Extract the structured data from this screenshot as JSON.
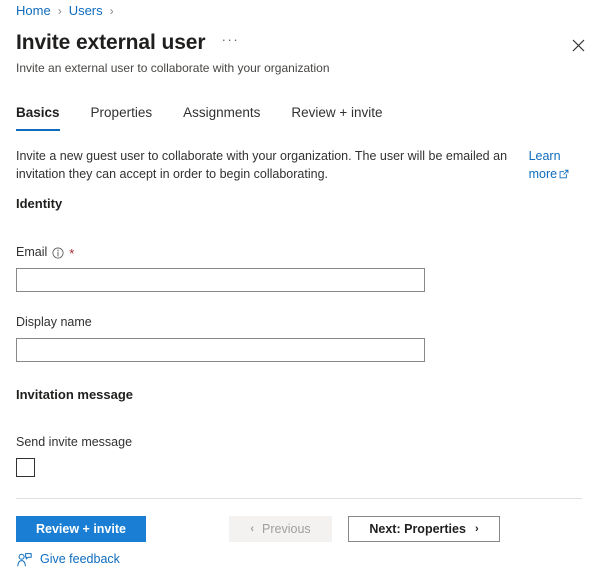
{
  "breadcrumb": {
    "items": [
      {
        "label": "Home"
      },
      {
        "label": "Users"
      }
    ],
    "separator": "›"
  },
  "header": {
    "title": "Invite external user",
    "more_options": "···",
    "more_options_name": "more-options-ellipsis",
    "subtitle": "Invite an external user to collaborate with your organization",
    "close_icon": "close-icon"
  },
  "tabs": [
    {
      "label": "Basics",
      "active": true
    },
    {
      "label": "Properties",
      "active": false
    },
    {
      "label": "Assignments",
      "active": false
    },
    {
      "label": "Review + invite",
      "active": false
    }
  ],
  "description": {
    "text": "Invite a new guest user to collaborate with your organization. The user will be emailed an invitation they can accept in order to begin collaborating.",
    "learn_more": "Learn more",
    "learn_more_icon": "external-link-icon"
  },
  "sections": {
    "identity": {
      "heading": "Identity",
      "email": {
        "label": "Email",
        "info_icon": "info-icon",
        "required_marker": "*",
        "value": "",
        "placeholder": ""
      },
      "display_name": {
        "label": "Display name",
        "value": "",
        "placeholder": ""
      }
    },
    "invitation_message": {
      "heading": "Invitation message",
      "send_invite": {
        "label": "Send invite message",
        "checked": false
      }
    }
  },
  "footer": {
    "primary_button": "Review + invite",
    "previous_button": "Previous",
    "previous_chevron": "‹",
    "next_button": "Next: Properties",
    "next_chevron": "›",
    "feedback": "Give feedback",
    "feedback_icon": "person-feedback-icon"
  },
  "colors": {
    "accent": "#0f6cbd",
    "primary_button_bg": "#1a7fd4",
    "required_red": "#a4262c",
    "input_border": "#8a8886",
    "divider": "#e1dfdd",
    "disabled_bg": "#f3f2f1",
    "disabled_text": "#a19f9d"
  }
}
